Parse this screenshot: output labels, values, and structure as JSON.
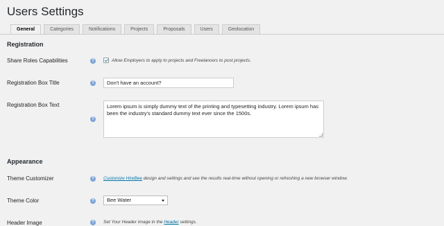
{
  "page_title": "Users Settings",
  "tabs": [
    {
      "label": "General",
      "active": true
    },
    {
      "label": "Categories"
    },
    {
      "label": "Notifications"
    },
    {
      "label": "Projects"
    },
    {
      "label": "Proposals"
    },
    {
      "label": "Users"
    },
    {
      "label": "Geolocation"
    }
  ],
  "registration": {
    "section_title": "Registration",
    "share_roles": {
      "label": "Share Roles Capabilities",
      "checked": true,
      "description": "Allow Employers to apply to projects and Freelancers to post projects."
    },
    "box_title": {
      "label": "Registration Box Title",
      "value": "Don't have an account?"
    },
    "box_text": {
      "label": "Registration Box Text",
      "value": "Lorem ipsum is simply dummy text of the printing and typesetting industry. Lorem ipsum has been the industry's standard dummy text ever since the 1500s."
    }
  },
  "appearance": {
    "section_title": "Appearance",
    "theme_customizer": {
      "label": "Theme Customizer",
      "link": "Customize HireBee",
      "description": " design and settings and see the results real-time without opening or refreshing a new browser window."
    },
    "theme_color": {
      "label": "Theme Color",
      "selected": "Bee Water"
    },
    "header_image": {
      "label": "Header Image",
      "description_pre": "Set Your Header Image in the ",
      "link": "Header",
      "description_post": " settings."
    }
  },
  "colors": {
    "accent": "#0073aa",
    "help_icon": "#7ea4d6",
    "background": "#f1f1f1"
  },
  "icons": {
    "help": "help-icon",
    "checkbox": "checkbox-check-icon",
    "select_arrow": "chevron-down-icon"
  }
}
